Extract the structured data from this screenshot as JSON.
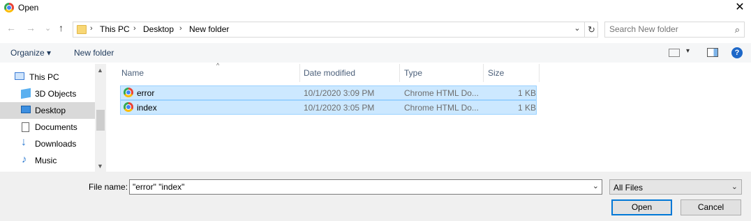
{
  "window": {
    "title": "Open",
    "close_glyph": "✕"
  },
  "nav": {
    "back": "←",
    "forward": "→",
    "recent": "⌄",
    "up": "↑"
  },
  "address": {
    "crumbs": [
      "This PC",
      "Desktop",
      "New folder"
    ],
    "separator": "›",
    "dropdown": "⌄",
    "refresh": "↻"
  },
  "search": {
    "placeholder": "Search New folder",
    "icon": "⌕"
  },
  "toolbar": {
    "organize": "Organize ▾",
    "new_folder": "New folder",
    "view_dropdown": "▾",
    "help": "?"
  },
  "sidebar": {
    "items": [
      {
        "label": "This PC",
        "icon": "computer-icon"
      },
      {
        "label": "3D Objects",
        "icon": "cube-icon"
      },
      {
        "label": "Desktop",
        "icon": "desktop-icon"
      },
      {
        "label": "Documents",
        "icon": "document-icon"
      },
      {
        "label": "Downloads",
        "icon": "download-icon"
      },
      {
        "label": "Music",
        "icon": "music-icon"
      }
    ],
    "scroll_up": "▲",
    "scroll_down": "▼"
  },
  "filelist": {
    "columns": [
      "Name",
      "Date modified",
      "Type",
      "Size"
    ],
    "sort_indicator": "^",
    "files": [
      {
        "name": "error",
        "date": "10/1/2020 3:09 PM",
        "type": "Chrome HTML Do...",
        "size": "1 KB",
        "icon": "chrome-icon"
      },
      {
        "name": "index",
        "date": "10/1/2020 3:05 PM",
        "type": "Chrome HTML Do...",
        "size": "1 KB",
        "icon": "chrome-icon"
      }
    ]
  },
  "footer": {
    "filename_label": "File name:",
    "filename_value": "\"error\" \"index\"",
    "filter_value": "All Files",
    "dropdown": "⌄",
    "open_label": "Open",
    "cancel_label": "Cancel"
  },
  "colors": {
    "selection": "#cce8ff",
    "selection_border": "#99d1ff",
    "accent": "#0078d7"
  }
}
